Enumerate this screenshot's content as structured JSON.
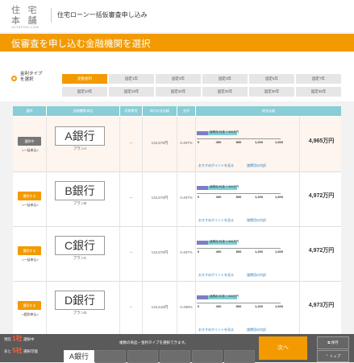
{
  "header": {
    "logo_line1": "住 宅",
    "logo_line2": "本 舗",
    "logo_sub": "JUTAPON.COM",
    "title": "住宅ローン一括仮審査申し込み"
  },
  "banner": {
    "title": "仮審査を申し込む金融機関を選択"
  },
  "filter": {
    "label_line1": "金利タイプ",
    "label_line2": "を選択",
    "rates": [
      "変動金利",
      "固定1年",
      "固定2年",
      "固定3年",
      "固定5年",
      "固定7年",
      "固定10年",
      "固定15年",
      "固定20年",
      "固定25年",
      "固定30年",
      "固定35年"
    ],
    "active_index": 0
  },
  "table": {
    "headers": [
      "選択",
      "金融機関/商品",
      "初期費用",
      "毎月の支払額",
      "金利",
      "総支払額"
    ],
    "rows": [
      {
        "select_label": "選択中",
        "selected": true,
        "select_type": "<一括申込>",
        "bank": "A銀行",
        "plan": "プランA",
        "initial": "－",
        "monthly": "134,576円",
        "rate": "0.497%",
        "bar_label": "諸費用 利息 7,965万円",
        "total": "4,965万円",
        "link1": "おすすめポイントを見る",
        "link2": "諸費用の内訳",
        "bar_fraction": 0.158
      },
      {
        "select_label": "選択する",
        "selected": false,
        "select_type": "<一括申込>",
        "bank": "B銀行",
        "plan": "プランB",
        "initial": "－",
        "monthly": "134,576円",
        "rate": "0.497%",
        "bar_label": "諸費用 利息 7,965万円",
        "total": "4,972万円",
        "link1": "おすすめポイントを見る",
        "link2": "諸費用の内訳",
        "bar_fraction": 0.158
      },
      {
        "select_label": "選択する",
        "selected": false,
        "select_type": "<一括申込>",
        "bank": "C銀行",
        "plan": "プランC",
        "initial": "－",
        "monthly": "134,576円",
        "rate": "0.497%",
        "bar_label": "諸費用 利息 7,965万円",
        "total": "4,972万円",
        "link1": "おすすめポイントを見る",
        "link2": "諸費用の内訳",
        "bar_fraction": 0.158
      },
      {
        "select_label": "選択する",
        "selected": false,
        "select_type": "<個別申込>",
        "bank": "D銀行",
        "plan": "プランD",
        "initial": "－",
        "monthly": "134,616円",
        "rate": "0.499%",
        "bar_label": "諸費用 利息 7,965万円",
        "total": "4,973万円",
        "link1": "おすすめポイントを見る",
        "link2": "諸費用の内訳",
        "bar_fraction": 0.158
      }
    ],
    "axis_ticks": [
      "0",
      "400",
      "800",
      "1,200",
      "1,600"
    ]
  },
  "footer": {
    "now_prefix": "現在",
    "now_count": "1社",
    "now_suffix": "選択中",
    "rest_prefix": "あと",
    "rest_count": "5社",
    "rest_suffix": "選択可能",
    "message": "複数の商品・金利タイプを選択できます。",
    "slot1": "A銀行",
    "next": "次へ",
    "save": "保存",
    "top": "トップ"
  },
  "colors": {
    "accent": "#f29a00",
    "table_header": "#89cdd6",
    "bar_interest": "#82cfd6",
    "bar_fees": "#7b7fc5",
    "footer": "#5a5a5a"
  }
}
